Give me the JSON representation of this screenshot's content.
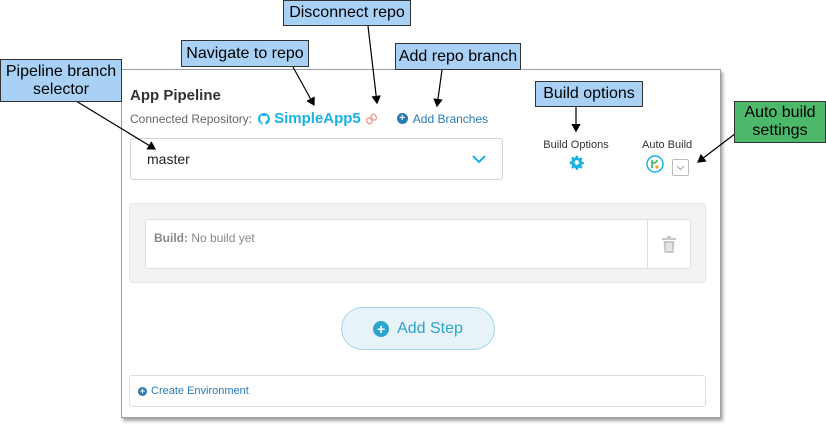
{
  "panel": {
    "title": "App Pipeline",
    "repo_label": "Connected Repository:",
    "repo_name": "SimpleApp5",
    "add_branches": "Add Branches",
    "branch": "master",
    "build_options": "Build Options",
    "auto_build": "Auto Build",
    "build_label": "Build:",
    "build_status": "No build yet",
    "add_step": "Add Step",
    "create_environment": "Create Environment"
  },
  "callouts": {
    "pipeline_branch_selector": "Pipeline branch selector",
    "navigate_to_repo": "Navigate to repo",
    "disconnect_repo": "Disconnect repo",
    "add_repo_branch": "Add repo branch",
    "build_options": "Build options",
    "auto_build_settings": "Auto build settings"
  },
  "colors": {
    "accent": "#19b1e6",
    "link": "#2a7ab8",
    "callout_blue": "#a8d1f5",
    "callout_green": "#4cb869"
  }
}
